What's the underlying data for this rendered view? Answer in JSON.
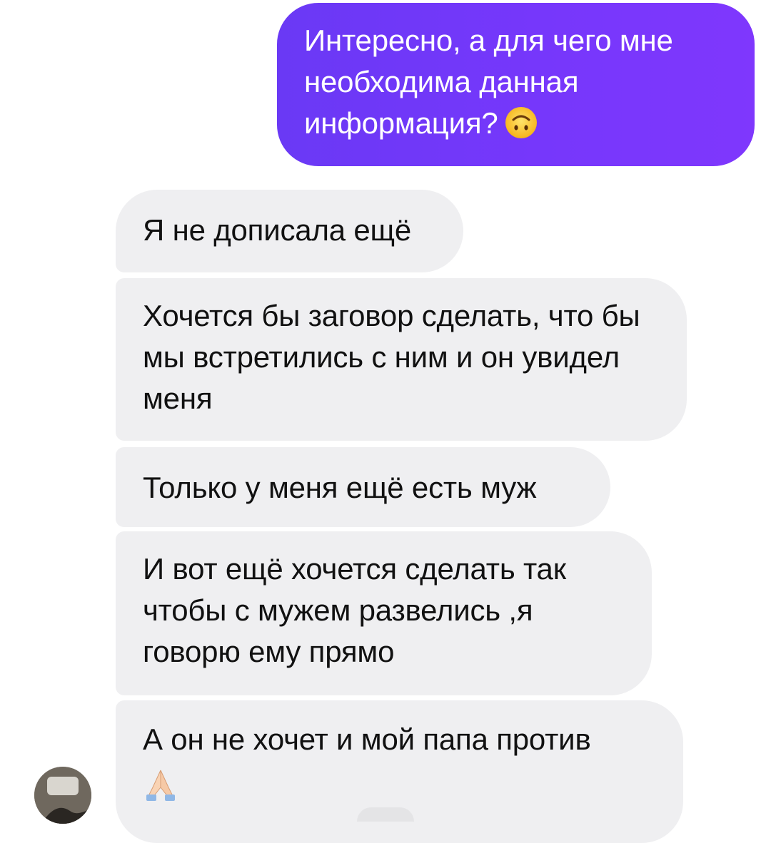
{
  "conversation": {
    "outgoing": [
      {
        "text": "Интересно, а для чего мне необходима данная информация?",
        "emoji": "upside-down-face-icon"
      }
    ],
    "incoming": [
      {
        "text": "Я не дописала ещё"
      },
      {
        "text": "Хочется бы заговор сделать, что бы мы встретились с ним и он увидел меня"
      },
      {
        "text": "Только у меня ещё есть муж"
      },
      {
        "text": "И вот ещё хочется сделать так чтобы с мужем развелись ,я говорю ему прямо"
      },
      {
        "text": "А он не хочет и мой папа против",
        "emoji": "folded-hands-icon"
      }
    ]
  },
  "colors": {
    "outgoing_bubble": "#7637fb",
    "incoming_bubble": "#efeff1",
    "outgoing_text": "#ffffff",
    "incoming_text": "#111111"
  },
  "avatar": {
    "icon": "contact-avatar"
  }
}
